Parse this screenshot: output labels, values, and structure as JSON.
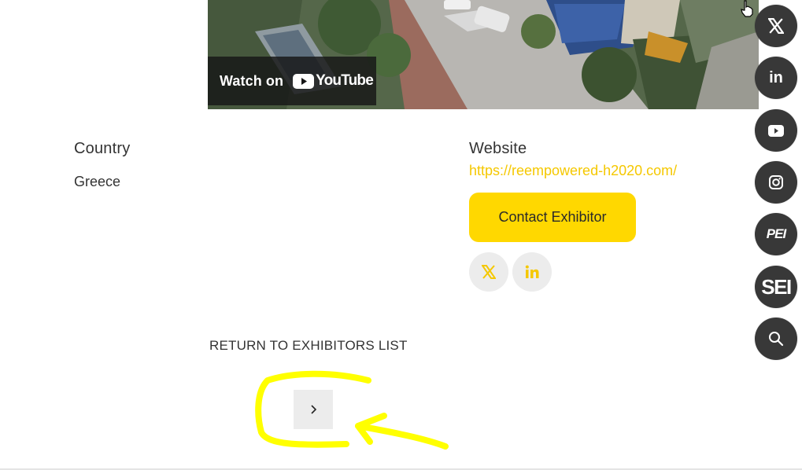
{
  "video": {
    "watch_on": "Watch on",
    "youtube_word": "YouTube"
  },
  "country": {
    "label": "Country",
    "value": "Greece"
  },
  "website": {
    "label": "Website",
    "url": "https://reempowered-h2020.com/"
  },
  "contact": {
    "label": "Contact Exhibitor"
  },
  "share_icons": [
    "x-icon",
    "linkedin-icon"
  ],
  "return_link": "RETURN TO EXHIBITORS LIST",
  "pagination": {
    "next_glyph": "›"
  },
  "social_rail": [
    {
      "name": "x-icon"
    },
    {
      "name": "linkedin-icon",
      "text": "in"
    },
    {
      "name": "youtube-icon"
    },
    {
      "name": "instagram-icon"
    },
    {
      "name": "pei-logo",
      "text": "PEI"
    },
    {
      "name": "sei-logo",
      "text": "SEI"
    },
    {
      "name": "search-icon"
    }
  ],
  "colors": {
    "accent_yellow": "#ffd800",
    "link_yellow": "#f5c800",
    "rail_dark": "#383838",
    "annotation_yellow": "#ffff00",
    "light_gray": "#ececec"
  }
}
